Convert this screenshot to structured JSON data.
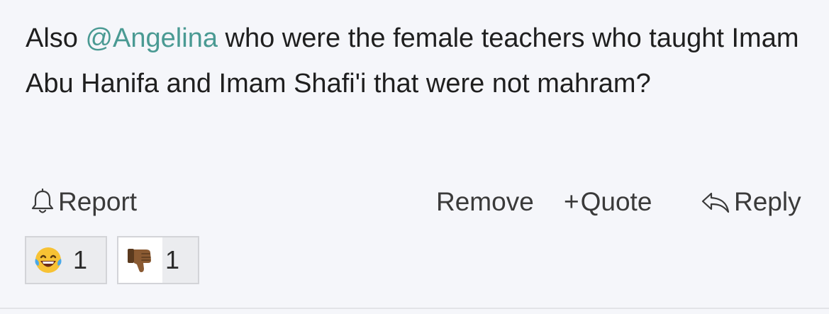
{
  "post": {
    "text_before": "Also ",
    "mention": "@Angelina",
    "text_after": " who were the female teachers who taught Imam Abu Hanifa and Imam Shafi'i that were not mahram?"
  },
  "actions": {
    "report": "Report",
    "remove": "Remove",
    "quote": "Quote",
    "quote_prefix": "+",
    "reply": "Reply"
  },
  "reactions": [
    {
      "icon": "laughing-tears-emoji-icon",
      "count": "1"
    },
    {
      "icon": "thumbs-down-emoji-icon",
      "count": "1"
    }
  ],
  "colors": {
    "mention": "#4a9a93",
    "background": "#f5f6fa",
    "reaction_bg": "#ebecef",
    "reaction_border": "#d3d4d8"
  }
}
